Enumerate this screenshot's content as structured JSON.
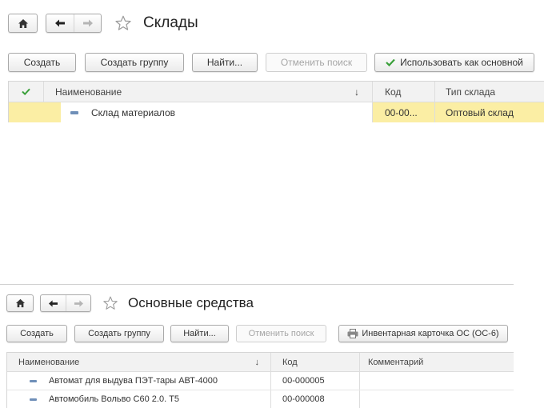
{
  "warehouses": {
    "title": "Склады",
    "toolbar": {
      "create": "Создать",
      "create_group": "Создать группу",
      "find": "Найти...",
      "cancel_search": "Отменить поиск",
      "use_as_main": "Использовать как основной"
    },
    "columns": {
      "name": "Наименование",
      "sort_arrow": "↓",
      "code": "Код",
      "type": "Тип склада"
    },
    "rows": [
      {
        "name": "Склад материалов",
        "code": "00-00...",
        "type": "Оптовый склад"
      }
    ]
  },
  "fixed_assets": {
    "title": "Основные средства",
    "toolbar": {
      "create": "Создать",
      "create_group": "Создать группу",
      "find": "Найти...",
      "cancel_search": "Отменить поиск",
      "inventory_card": "Инвентарная карточка ОС (ОС-6)"
    },
    "columns": {
      "name": "Наименование",
      "sort_arrow": "↓",
      "code": "Код",
      "comment": "Комментарий"
    },
    "rows": [
      {
        "name": "Автомат для выдува ПЭТ-тары АВТ-4000",
        "code": "00-000005",
        "comment": ""
      },
      {
        "name": "Автомобиль Вольво С60 2.0. Т5",
        "code": "00-000008",
        "comment": ""
      }
    ]
  },
  "colors": {
    "selected_row": "#fbeea4",
    "check_green": "#3aa03a",
    "item_dash": "#6f8fb8"
  },
  "icons": [
    "home-icon",
    "back-arrow-icon",
    "forward-arrow-icon",
    "star-icon",
    "checkmark-icon",
    "printer-icon",
    "item-dash-icon"
  ]
}
